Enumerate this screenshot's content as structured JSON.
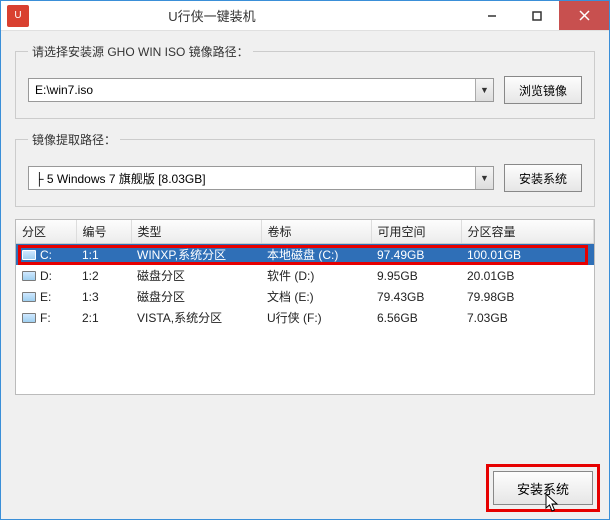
{
  "titlebar": {
    "app_icon_text": "U",
    "title": "U行侠一键装机"
  },
  "group_source": {
    "legend": "请选择安装源 GHO WIN ISO 镜像路径：",
    "value": "E:\\win7.iso",
    "browse": "浏览镜像"
  },
  "group_extract": {
    "legend": "镜像提取路径：",
    "value": "├ 5 Windows 7 旗舰版 [8.03GB]",
    "install": "安装系统"
  },
  "table": {
    "headers": [
      "分区",
      "编号",
      "类型",
      "卷标",
      "可用空间",
      "分区容量"
    ],
    "rows": [
      {
        "part": "C:",
        "num": "1:1",
        "type": "WINXP,系统分区",
        "vol": "本地磁盘 (C:)",
        "free": "97.49GB",
        "cap": "100.01GB",
        "selected": true
      },
      {
        "part": "D:",
        "num": "1:2",
        "type": "磁盘分区",
        "vol": "软件 (D:)",
        "free": "9.95GB",
        "cap": "20.01GB",
        "selected": false
      },
      {
        "part": "E:",
        "num": "1:3",
        "type": "磁盘分区",
        "vol": "文档 (E:)",
        "free": "79.43GB",
        "cap": "79.98GB",
        "selected": false
      },
      {
        "part": "F:",
        "num": "2:1",
        "type": "VISTA,系统分区",
        "vol": "U行侠 (F:)",
        "free": "6.56GB",
        "cap": "7.03GB",
        "selected": false
      }
    ]
  },
  "footer": {
    "install": "安装系统"
  }
}
